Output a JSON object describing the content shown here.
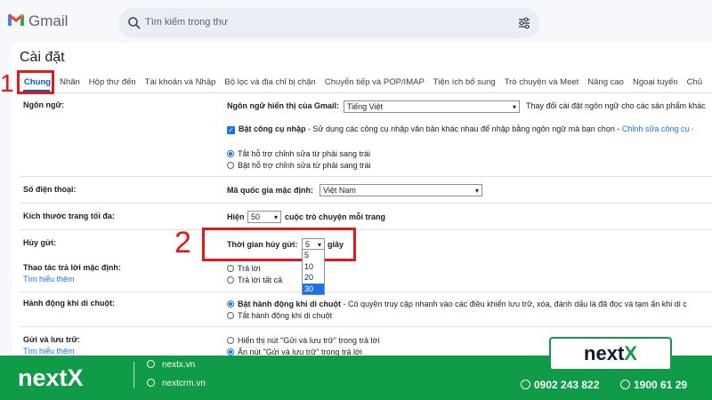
{
  "app": {
    "name": "Gmail"
  },
  "search": {
    "placeholder": "Tìm kiếm trong thư"
  },
  "page": {
    "title": "Cài đặt"
  },
  "tabs": [
    "Chung",
    "Nhãn",
    "Hộp thư đến",
    "Tài khoản và Nhập",
    "Bộ lọc và địa chỉ bị chặn",
    "Chuyển tiếp và POP/IMAP",
    "Tiện ích bổ sung",
    "Trò chuyện và Meet",
    "Nâng cao",
    "Ngoại tuyến",
    "Chủ"
  ],
  "settings": {
    "language": {
      "label": "Ngôn ngữ:",
      "display_label": "Ngôn ngữ hiển thị của Gmail:",
      "display_value": "Tiếng Việt",
      "change_link": "Thay đổi cài đặt ngôn ngữ cho các sản phẩm khác",
      "input_tools_bold": "Bật công cụ nhập",
      "input_tools_desc": " - Sử dụng các công cụ nhập văn bản khác nhau để nhập bằng ngôn ngữ mà bạn chọn - ",
      "input_tools_link": "Chỉnh sửa công cụ -",
      "rtl_off": "Tắt hỗ trợ chỉnh sửa từ phải sang trái",
      "rtl_on": "Bật hỗ trợ chỉnh sửa từ phải sang trái"
    },
    "phone": {
      "label": "Số điện thoại:",
      "country_label": "Mã quốc gia mặc định:",
      "country_value": "Việt Nam"
    },
    "page_size": {
      "label": "Kích thước trang tối đa:",
      "show": "Hiện",
      "value": "50",
      "suffix": "cuộc trò chuyện mỗi trang"
    },
    "undo_send": {
      "label": "Hủy gửi:",
      "period_label": "Thời gian hủy gửi:",
      "value": "5",
      "unit": "giây",
      "options": [
        "5",
        "10",
        "20",
        "30"
      ],
      "highlighted_option": "30"
    },
    "reply": {
      "label": "Thao tác trả lời mặc định:",
      "learn_more": "Tìm hiểu thêm",
      "reply": "Trả lời",
      "reply_all": "Trả lời tất cả"
    },
    "hover": {
      "label": "Hành động khi di chuột:",
      "enable_bold": "Bật hành động khi di chuột",
      "enable_desc": " - Có quyền truy cập nhanh vào các điều khiển lưu trữ, xóa, đánh dấu là đã đọc và tạm ẩn khi di c",
      "disable": "Tắt hành động khi di chuột"
    },
    "send_archive": {
      "label": "Gửi và lưu trữ:",
      "learn_more": "Tìm hiểu thêm",
      "show": "Hiển thị nút \"Gửi và lưu trữ\" trong trả lời",
      "hide": "Ẩn nút \"Gửi và lưu trữ\" trong trả lời"
    }
  },
  "annotations": {
    "step1": "1",
    "step2": "2"
  },
  "footer": {
    "brand": "nextX",
    "web1": "nextx.vn",
    "web2": "nextcrm.vn",
    "phone1": "0902 243 822",
    "phone2": "1900 61 29"
  },
  "logo": {
    "part1": "next",
    "part2": "X"
  },
  "colors": {
    "annotation_red": "#e0191b",
    "brand_green": "#0f9b48",
    "accent_blue": "#1a73e8"
  }
}
